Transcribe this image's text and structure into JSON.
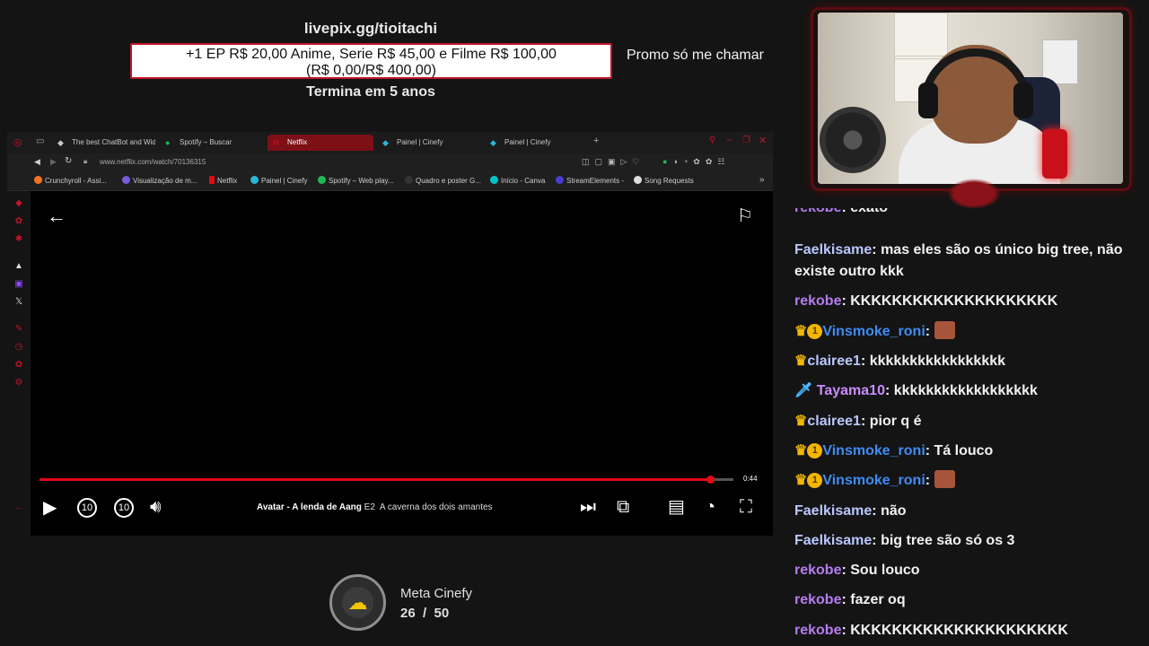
{
  "overlay": {
    "livepix_url": "livepix.gg/tioitachi",
    "goal_line1": "+1 EP R$ 20,00 Anime, Serie R$ 45,00 e Filme R$ 100,00",
    "goal_line2": "(R$ 0,00/R$ 400,00)",
    "goal_ends": "Termina em 5 anos",
    "promo": "Promo só me chamar"
  },
  "browser": {
    "tabs": [
      {
        "label": "The best ChatBot and Wid",
        "icon": "chatbot-icon"
      },
      {
        "label": "Spotify – Buscar",
        "icon": "spotify-icon"
      },
      {
        "label": "Netflix",
        "icon": "netflix-icon",
        "active": true
      },
      {
        "label": "Painel | Cinefy",
        "icon": "cinefy-icon"
      },
      {
        "label": "Painel | Cinefy",
        "icon": "cinefy-icon"
      }
    ],
    "url": "www.netflix.com/watch/70136315",
    "bookmarks": [
      {
        "label": "Crunchyroll - Assi...",
        "color": "#f47521"
      },
      {
        "label": "Visualização de m...",
        "color": "#7b5cd6"
      },
      {
        "label": "Netflix",
        "color": "#e50914"
      },
      {
        "label": "Painel | Cinefy",
        "color": "#29b6d8"
      },
      {
        "label": "Spotify – Web play...",
        "color": "#1db954"
      },
      {
        "label": "Quadro e poster G...",
        "color": "#333333"
      },
      {
        "label": "Início - Canva",
        "color": "#00c4cc"
      },
      {
        "label": "StreamElements -",
        "color": "#4b3bd6"
      },
      {
        "label": "Song Requests",
        "color": "#dddddd"
      }
    ]
  },
  "player": {
    "progress": 0.967,
    "time_left": "0:44",
    "show_title": "Avatar - A lenda de Aang",
    "episode": "E2",
    "episode_title": "A caverna dos dois amantes",
    "skip_back": "10",
    "skip_forward": "10"
  },
  "meta": {
    "label": "Meta Cinefy",
    "count": "26  /  50"
  },
  "chat": [
    {
      "user": "rekobe",
      "text": "exato",
      "color": "#b57cf0"
    },
    {
      "user": "Faelkisame",
      "text": "mas eles são os único big tree, não existe outro kkk",
      "color": "#b9c8ff"
    },
    {
      "user": "rekobe",
      "text": "KKKKKKKKKKKKKKKKKKKK",
      "color": "#b57cf0"
    },
    {
      "user": "Vinsmoke_roni",
      "text": "",
      "color": "#3f8cf5",
      "badges": "crown+1",
      "emote": true
    },
    {
      "user": "clairee1",
      "text": "kkkkkkkkkkkkkkkkk",
      "color": "#b9c8ff",
      "badges": "crown"
    },
    {
      "user": "Tayama10",
      "text": "kkkkkkkkkkkkkkkkkk",
      "color": "#c98cff",
      "badges": "sword"
    },
    {
      "user": "clairee1",
      "text": "pior q é",
      "color": "#b9c8ff",
      "badges": "crown"
    },
    {
      "user": "Vinsmoke_roni",
      "text": "Tá louco",
      "color": "#3f8cf5",
      "badges": "crown+1"
    },
    {
      "user": "Vinsmoke_roni",
      "text": "",
      "color": "#3f8cf5",
      "badges": "crown+1",
      "emote": true
    },
    {
      "user": "Faelkisame",
      "text": "não",
      "color": "#b9c8ff"
    },
    {
      "user": "Faelkisame",
      "text": "big tree são só os 3",
      "color": "#b9c8ff"
    },
    {
      "user": "rekobe",
      "text": "Sou louco",
      "color": "#b57cf0"
    },
    {
      "user": "rekobe",
      "text": "fazer oq",
      "color": "#b57cf0"
    },
    {
      "user": "rekobe",
      "text": "KKKKKKKKKKKKKKKKKKKKK",
      "color": "#b57cf0"
    }
  ]
}
